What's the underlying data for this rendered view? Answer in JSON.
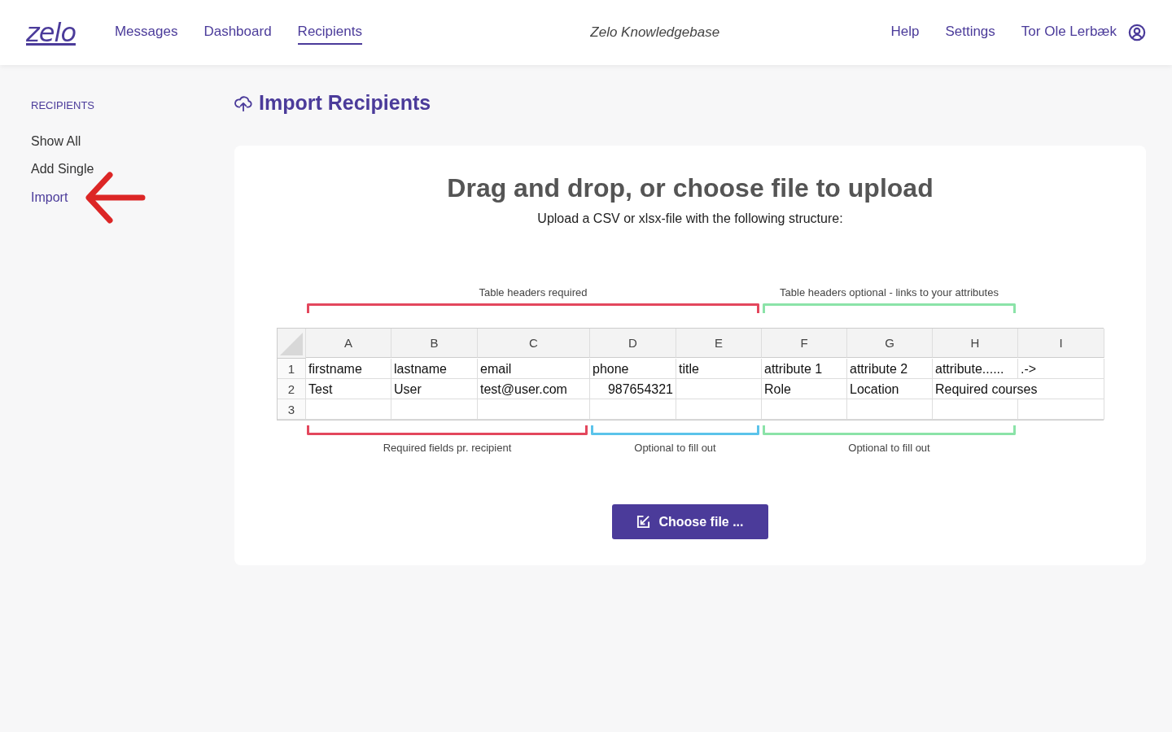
{
  "header": {
    "logo": "zelo",
    "nav": [
      {
        "label": "Messages",
        "selected": false
      },
      {
        "label": "Dashboard",
        "selected": false
      },
      {
        "label": "Recipients",
        "selected": true
      }
    ],
    "center_link": "Zelo Knowledgebase",
    "right_links": [
      "Help",
      "Settings"
    ],
    "user_name": "Tor Ole Lerbæk"
  },
  "sidebar": {
    "heading": "RECIPIENTS",
    "items": [
      {
        "label": "Show All",
        "selected": false
      },
      {
        "label": "Add Single",
        "selected": false
      },
      {
        "label": "Import",
        "selected": true
      }
    ]
  },
  "page_title": "Import Recipients",
  "upload": {
    "heading": "Drag and drop, or choose file to upload",
    "subtitle": "Upload a CSV or xlsx-file with the following structure:",
    "top_brackets": [
      {
        "kind": "required",
        "label": "Table headers required",
        "color": "#e3475d"
      },
      {
        "kind": "attributes",
        "label": "Table headers optional - links to your attributes",
        "color": "#8be3a8"
      }
    ],
    "sheet": {
      "columns": [
        "A",
        "B",
        "C",
        "D",
        "E",
        "F",
        "G",
        "H",
        "I"
      ],
      "rows": [
        {
          "number": "1",
          "cells": [
            "firstname",
            "lastname",
            "email",
            "phone",
            "title",
            "attribute 1",
            "attribute 2",
            "attribute......",
            ".->"
          ]
        },
        {
          "number": "2",
          "cells": [
            "Test",
            "User",
            "test@user.com",
            "987654321",
            "",
            "Role",
            "Location",
            "Required courses",
            ""
          ]
        },
        {
          "number": "3",
          "cells": [
            "",
            "",
            "",
            "",
            "",
            "",
            "",
            "",
            ""
          ]
        }
      ]
    },
    "bottom_brackets": [
      {
        "kind": "required",
        "label": "Required fields pr. recipient",
        "color": "#e3475d"
      },
      {
        "kind": "optional",
        "label": "Optional to fill out",
        "color": "#5bc3ea"
      },
      {
        "kind": "attributes",
        "label": "Optional to fill out",
        "color": "#8be3a8"
      }
    ],
    "button": "Choose file ..."
  }
}
